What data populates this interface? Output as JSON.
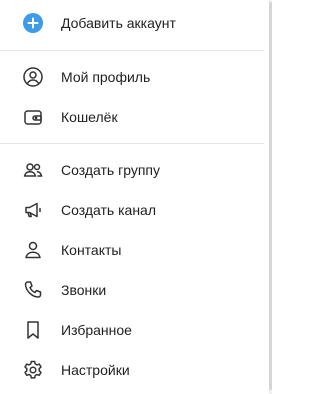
{
  "menu": {
    "add_account": {
      "label": "Добавить аккаунт",
      "icon": "plus-circle-icon",
      "accent": "#3d9be9"
    },
    "profile": {
      "label": "Мой профиль",
      "icon": "user-circle-icon"
    },
    "wallet": {
      "label": "Кошелёк",
      "icon": "wallet-icon"
    },
    "new_group": {
      "label": "Создать группу",
      "icon": "group-icon"
    },
    "new_channel": {
      "label": "Создать канал",
      "icon": "megaphone-icon"
    },
    "contacts": {
      "label": "Контакты",
      "icon": "person-icon"
    },
    "calls": {
      "label": "Звонки",
      "icon": "phone-icon"
    },
    "saved": {
      "label": "Избранное",
      "icon": "bookmark-icon"
    },
    "settings": {
      "label": "Настройки",
      "icon": "gear-icon"
    }
  }
}
